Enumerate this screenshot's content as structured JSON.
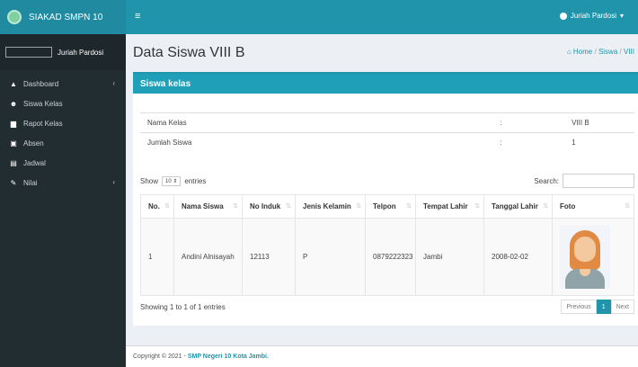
{
  "app": {
    "title": "SIAKAD SMPN 10"
  },
  "topbar": {
    "menu_icon": "hamburger-icon",
    "user": "Juriah Pardosi",
    "caret": "▾"
  },
  "sidebar": {
    "user_name": "Juriah Pardosi",
    "items": [
      {
        "label": "Dashboard",
        "icon": "dashboard-icon",
        "glyph": "▲",
        "chevron": "‹"
      },
      {
        "label": "Siswa Kelas",
        "icon": "users-icon",
        "glyph": "☻",
        "chevron": ""
      },
      {
        "label": "Rapot Kelas",
        "icon": "book-icon",
        "glyph": "▆",
        "chevron": ""
      },
      {
        "label": "Absen",
        "icon": "calendar-icon",
        "glyph": "▣",
        "chevron": ""
      },
      {
        "label": "Jadwal",
        "icon": "schedule-icon",
        "glyph": "▤",
        "chevron": ""
      },
      {
        "label": "Nilai",
        "icon": "edit-icon",
        "glyph": "✎",
        "chevron": "‹"
      }
    ]
  },
  "header": {
    "title": "Data Siswa VIII B",
    "breadcrumb": [
      "Home",
      "Siswa",
      "VIII"
    ],
    "sep": "/"
  },
  "box": {
    "title": "Siswa kelas",
    "info": [
      {
        "label": "Nama Kelas",
        "colon": ":",
        "value": "VIII B"
      },
      {
        "label": "Jumlah Siswa",
        "colon": ":",
        "value": "1"
      }
    ]
  },
  "datatable": {
    "show_label": "Show",
    "length": "10",
    "entries_label": "entries",
    "search_label": "Search:",
    "columns": [
      "No.",
      "Nama Siswa",
      "No Induk",
      "Jenis Kelamin",
      "Telpon",
      "Tempat Lahir",
      "Tanggal Lahir",
      "Foto"
    ],
    "rows": [
      {
        "no": "1",
        "nama": "Andini Alnisayah",
        "induk": "12113",
        "jk": "P",
        "telpon": "0879222323",
        "tempat": "Jambi",
        "tanggal": "2008-02-02"
      }
    ],
    "info": "Showing 1 to 1 of 1 entries",
    "pager": {
      "prev": "Previous",
      "current": "1",
      "next": "Next"
    }
  },
  "footer": {
    "text": "Copyright © 2021 - ",
    "link": "SMP Negeri 10 Kota Jambi."
  }
}
